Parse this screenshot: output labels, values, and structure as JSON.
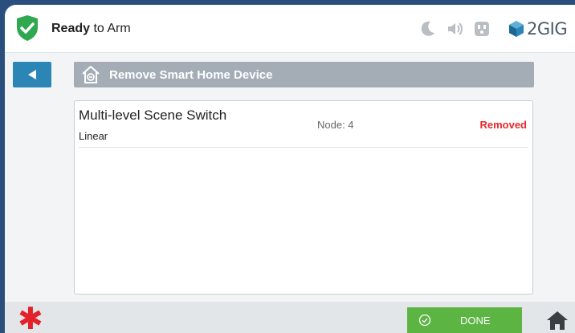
{
  "header": {
    "status_bold": "Ready",
    "status_rest": " to Arm",
    "brand": "2GIG",
    "icons": [
      "shield-check-icon",
      "moon-icon",
      "speaker-icon",
      "outlet-icon",
      "brand-cube-icon"
    ]
  },
  "title_bar": {
    "title": "Remove Smart Home Device",
    "icon": "house-minus-icon"
  },
  "devices": [
    {
      "name": "Multi-level Scene Switch",
      "manufacturer": "Linear",
      "node": "Node: 4",
      "status": "Removed"
    }
  ],
  "footer": {
    "done_label": "DONE",
    "emergency_icon": "asterisk-icon",
    "home_icon": "home-icon"
  },
  "colors": {
    "accent_blue": "#2b86b5",
    "done_green": "#5cb443",
    "removed_red": "#e8262b",
    "ready_green": "#2fa84f"
  }
}
